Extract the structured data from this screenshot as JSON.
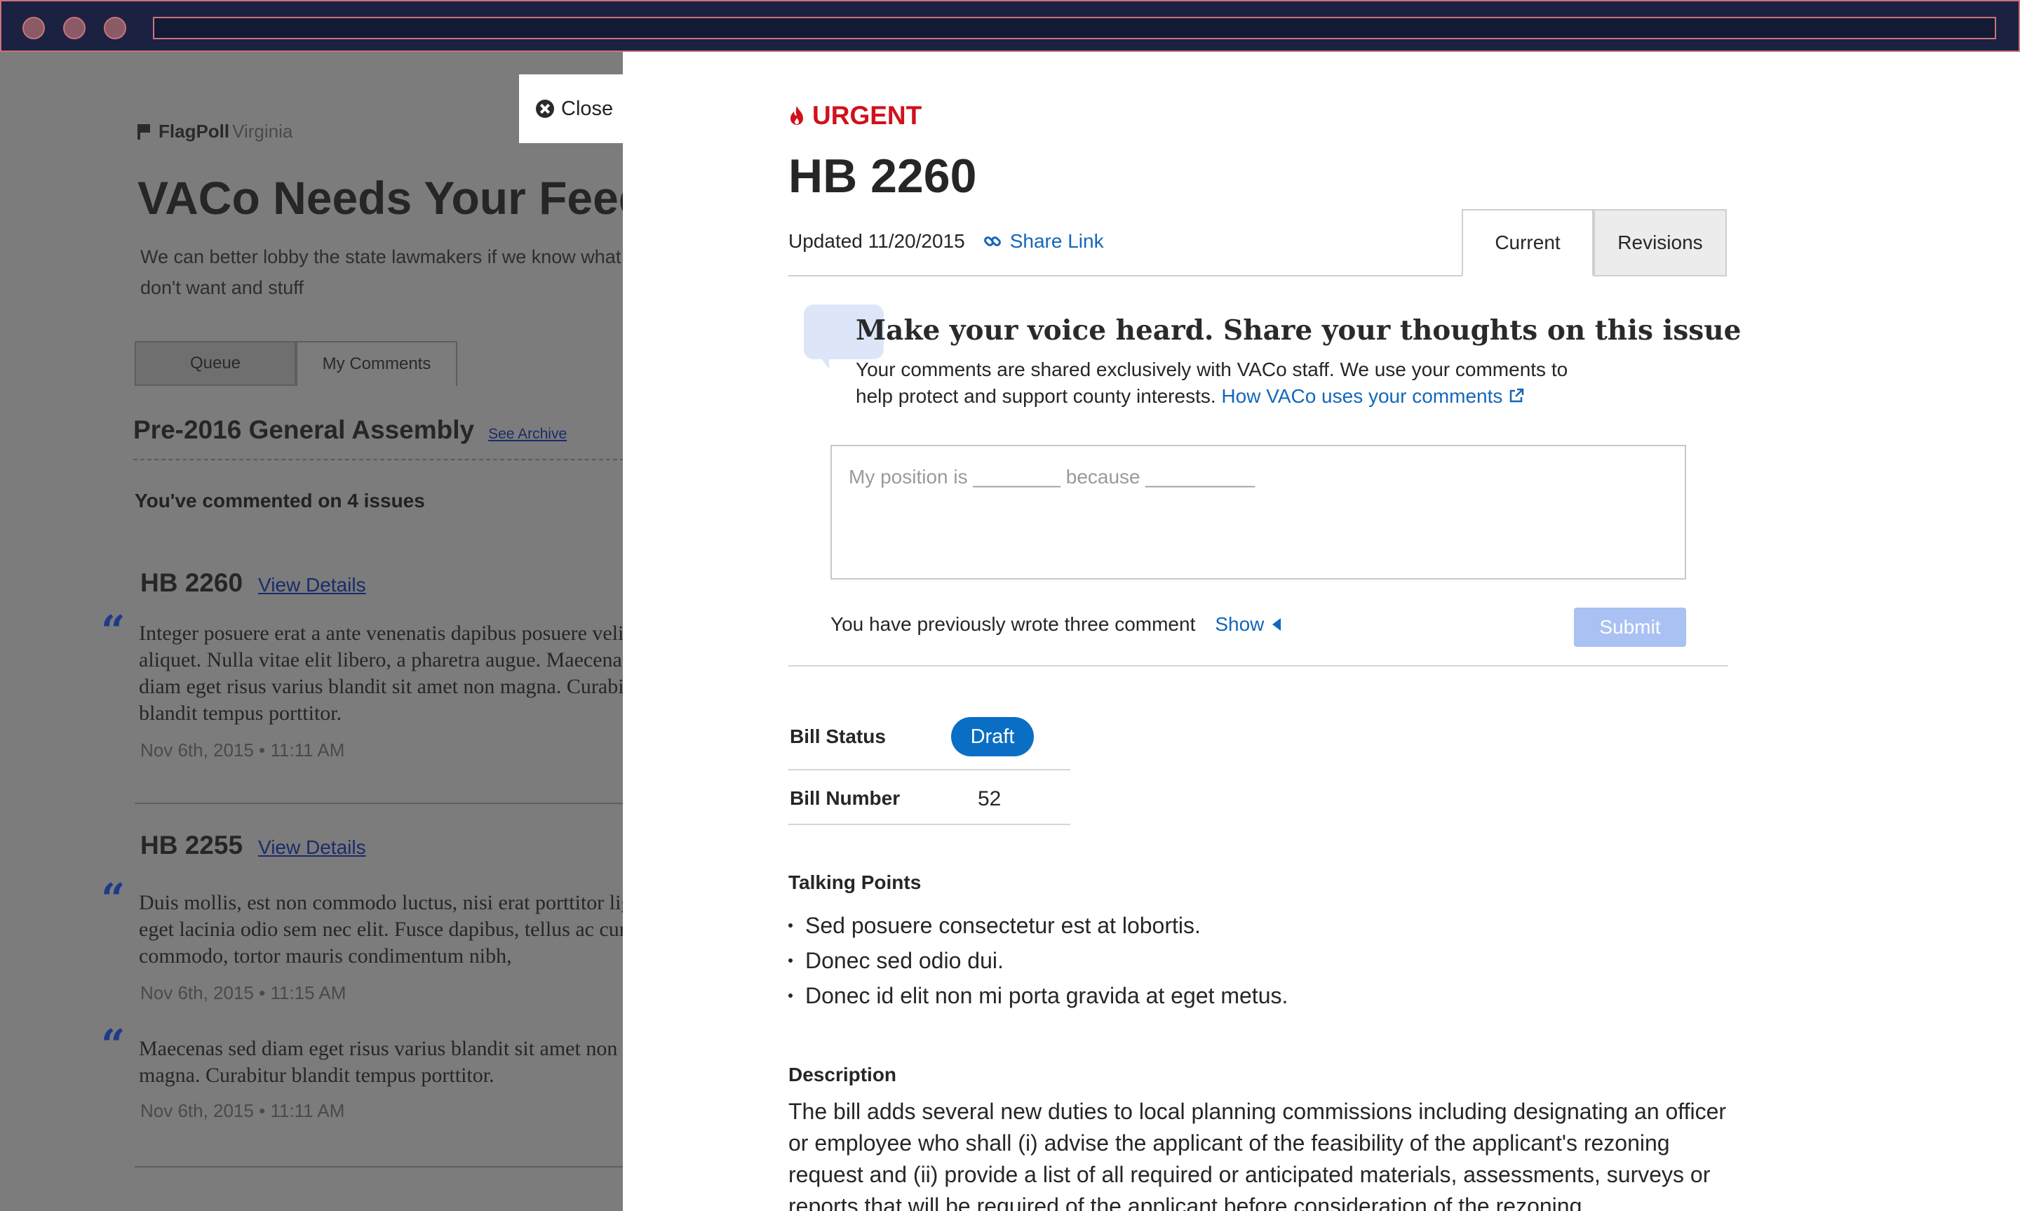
{
  "background_page": {
    "logo_bold": "FlagPoll",
    "logo_light": "Virginia",
    "heading": "VACo Needs Your Feedback",
    "lead": "We can better lobby the state lawmakers if we know what you want and don't want and stuff",
    "tabs": [
      "Queue",
      "My Comments"
    ],
    "section_title": "Pre-2016 General Assembly",
    "see_archive": "See Archive",
    "comment_count": "You've commented on 4 issues",
    "view_details": "View Details",
    "issues": [
      {
        "bill": "HB 2260",
        "comments": [
          {
            "text": "Integer posuere erat a ante venenatis dapibus posuere velit aliquet. Nulla vitae elit libero, a pharetra augue. Maecenas sed diam eget risus varius blandit sit amet non magna. Curabitur blandit tempus porttitor.",
            "date": "Nov 6th, 2015 • 11:11 AM"
          }
        ]
      },
      {
        "bill": "HB 2255",
        "comments": [
          {
            "text": "Duis mollis, est non commodo luctus, nisi erat porttitor ligula, eget lacinia odio sem nec elit. Fusce dapibus, tellus ac cursus commodo, tortor mauris condimentum nibh,",
            "date": "Nov 6th, 2015 • 11:15 AM"
          },
          {
            "text": "Maecenas sed diam eget risus varius blandit sit amet non magna. Curabitur blandit tempus porttitor.",
            "date": "Nov 6th, 2015 • 11:11 AM"
          }
        ]
      }
    ]
  },
  "close_label": "Close",
  "panel": {
    "urgent_label": "URGENT",
    "bill_title": "HB 2260",
    "updated": "Updated 11/20/2015",
    "share_link": "Share Link",
    "tabs": {
      "current": "Current",
      "revisions": "Revisions"
    },
    "voice_heading": "Make your voice heard. Share your thoughts on this issue",
    "voice_body": "Your comments are shared exclusively with VACo staff. We use your comments to help protect and support county interests.",
    "voice_link": "How VACo uses your comments",
    "comment_placeholder": "My position is ________ because __________",
    "previous_text": "You have previously wrote three comment",
    "show_label": "Show",
    "submit_label": "Submit",
    "bill_status_label": "Bill Status",
    "bill_status_value": "Draft",
    "bill_number_label": "Bill Number",
    "bill_number_value": "52",
    "talking_points_heading": "Talking Points",
    "talking_points": [
      "Sed posuere consectetur est at lobortis.",
      "Donec sed odio dui.",
      "Donec id elit non mi porta gravida at eget metus."
    ],
    "description_heading": "Description",
    "description": "The bill adds several new duties to local planning commissions including designating an officer or employee who shall (i) advise the applicant of the feasibility of the applicant's rezoning request and (ii) provide a list of all required or anticipated materials, assessments, surveys or reports that will be required of the applicant before consideration of the rezoning"
  },
  "colors": {
    "urgent": "#d0111b",
    "link": "#1467b8",
    "badge": "#0a6fc4",
    "submit": "#a9c1f3"
  }
}
